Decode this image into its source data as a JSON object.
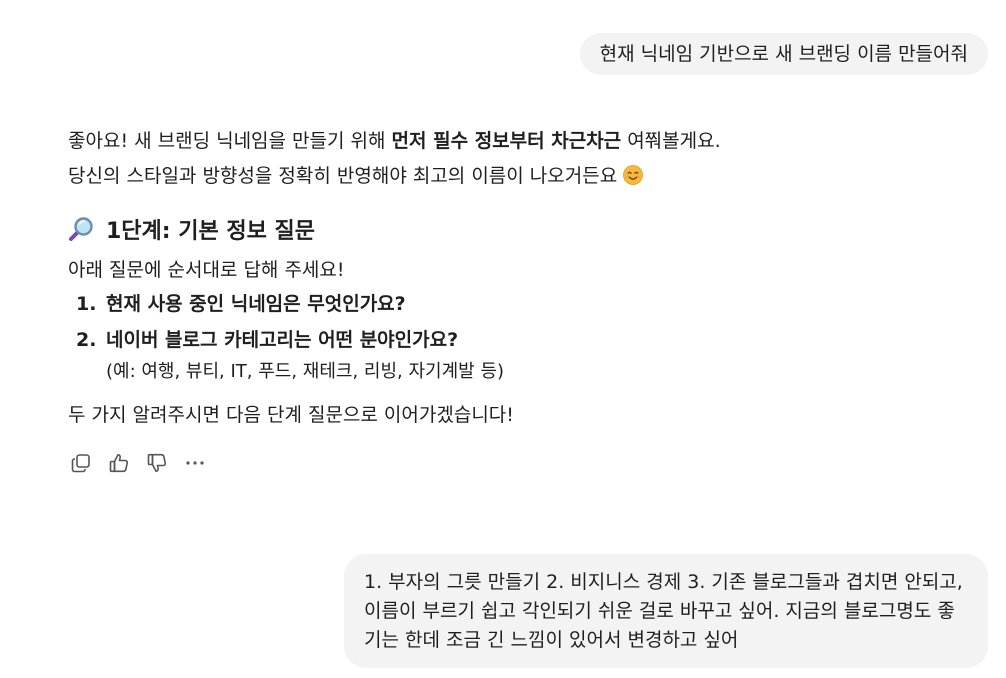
{
  "messages": {
    "user_1": "현재 닉네임 기반으로 새 브랜딩 이름 만들어줘",
    "assistant": {
      "line1_pre": "좋아요! 새 브랜딩 닉네임을 만들기 위해 ",
      "line1_bold": "먼저 필수 정보부터 차근차근",
      "line1_post": " 여쭤볼게요.",
      "line2": "당신의 스타일과 방향성을 정확히 반영해야 최고의 이름이 나오거든요",
      "line2_emoji": "smiling-face-emoji",
      "heading_icon": "magnifying-glass-icon",
      "heading": "1단계: 기본 정보 질문",
      "intro": "아래 질문에 순서대로 답해 주세요!",
      "questions": [
        {
          "num": "1.",
          "text": "현재 사용 중인 닉네임은 무엇인가요?"
        },
        {
          "num": "2.",
          "text": "네이버 블로그 카테고리는 어떤 분야인가요?",
          "note": "(예: 여행, 뷰티, IT, 푸드, 재테크, 리빙, 자기계발 등)"
        }
      ],
      "closing": "두 가지 알려주시면 다음 단계 질문으로 이어가겠습니다!"
    },
    "user_2": "1. 부자의 그릇 만들기 2. 비지니스 경제  3. 기존 블로그들과 겹치면 안되고, 이름이 부르기 쉽고 각인되기 쉬운 걸로 바꾸고 싶어. 지금의 블로그명도 좋기는 한데 조금 긴 느낌이 있어서 변경하고 싶어"
  },
  "actions": [
    {
      "icon": "copy-icon"
    },
    {
      "icon": "thumbs-up-icon"
    },
    {
      "icon": "thumbs-down-icon"
    },
    {
      "icon": "more-icon"
    }
  ],
  "colors": {
    "bubble_bg": "#f3f3f3",
    "text": "#1f1f1f",
    "icon": "#555555"
  }
}
